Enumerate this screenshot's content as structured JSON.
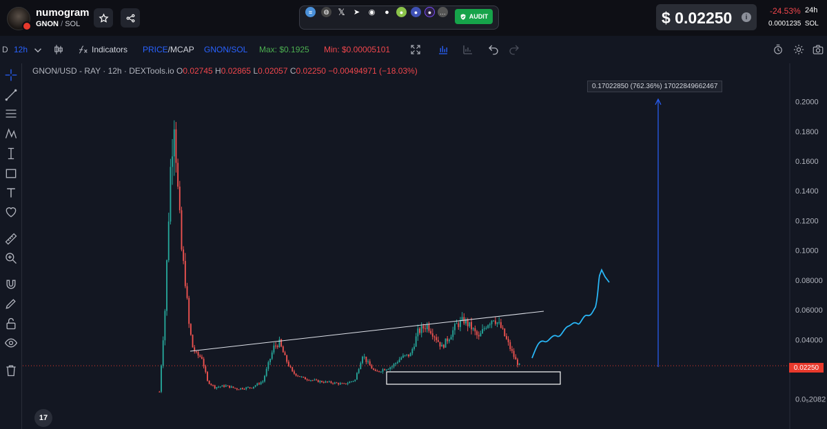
{
  "header": {
    "token_name": "numogram",
    "token_symbol": "GNON",
    "pair_sep": "/",
    "quote": "SOL",
    "audit_label": "AUDIT",
    "price": "$ 0.02250",
    "info_glyph": "i",
    "change": "-24.53%",
    "change_period": "24h",
    "sol_price": "0.0001235",
    "sol_label": "SOL",
    "socials": [
      "website-icon",
      "globe-icon",
      "x-icon",
      "telegram-icon",
      "reddit-icon",
      "github-icon",
      "coingecko-icon",
      "cmc-icon",
      "dextools-icon",
      "more-icon"
    ]
  },
  "toolbar": {
    "d_label": "D",
    "interval": "12h",
    "indicators": "Indicators",
    "price_mcap_a": "PRICE",
    "price_mcap_sep": "/",
    "price_mcap_b": "MCAP",
    "pair_toggle": "GNON/SOL",
    "max": "Max: $0.1925",
    "min": "Min: $0.00005101"
  },
  "legend": {
    "title": "GNON/USD - RAY · 12h · DEXTools.io",
    "o_label": "O",
    "o_val": "0.02745",
    "h_label": "H",
    "h_val": "0.02865",
    "l_label": "L",
    "l_val": "0.02057",
    "c_label": "C",
    "c_val": "0.02250",
    "change": "−0.00494971 (−18.03%)"
  },
  "measure_label": "0.17022850 (762.36%) 17022849662467",
  "current_price_tag": "0.02250",
  "tv_logo": "17",
  "colors": {
    "up": "#26a69a",
    "down": "#ef5350",
    "accent": "#2962ff",
    "drawing": "#29b6f6",
    "price_tag": "#e8392c"
  },
  "chart_data": {
    "type": "candlestick",
    "title": "GNON/USD - RAY · 12h · DEXTools.io",
    "y_ticks": [
      "0.2000",
      "0.1800",
      "0.1600",
      "0.1400",
      "0.1200",
      "0.1000",
      "0.08000",
      "0.06000",
      "0.04000",
      "0.02250",
      "0.0₅2082"
    ],
    "y_tick_values": [
      0.2,
      0.18,
      0.16,
      0.14,
      0.12,
      0.1,
      0.08,
      0.06,
      0.04,
      0.0225,
      0.0
    ],
    "ylim": [
      -0.002,
      0.21
    ],
    "approx_path": [
      [
        0,
        0.005
      ],
      [
        3,
        0.06
      ],
      [
        6,
        0.155
      ],
      [
        8,
        0.19
      ],
      [
        10,
        0.14
      ],
      [
        12,
        0.1
      ],
      [
        14,
        0.08
      ],
      [
        16,
        0.05
      ],
      [
        18,
        0.035
      ],
      [
        20,
        0.03
      ],
      [
        23,
        0.028
      ],
      [
        26,
        0.012
      ],
      [
        30,
        0.008
      ],
      [
        36,
        0.009
      ],
      [
        42,
        0.007
      ],
      [
        50,
        0.008
      ],
      [
        56,
        0.012
      ],
      [
        62,
        0.035
      ],
      [
        65,
        0.038
      ],
      [
        68,
        0.028
      ],
      [
        72,
        0.018
      ],
      [
        78,
        0.014
      ],
      [
        86,
        0.012
      ],
      [
        94,
        0.011
      ],
      [
        100,
        0.01
      ],
      [
        106,
        0.013
      ],
      [
        110,
        0.03
      ],
      [
        113,
        0.024
      ],
      [
        117,
        0.018
      ],
      [
        121,
        0.02
      ],
      [
        126,
        0.022
      ],
      [
        131,
        0.028
      ],
      [
        136,
        0.03
      ],
      [
        140,
        0.045
      ],
      [
        145,
        0.05
      ],
      [
        149,
        0.043
      ],
      [
        153,
        0.035
      ],
      [
        157,
        0.042
      ],
      [
        161,
        0.05
      ],
      [
        165,
        0.053
      ],
      [
        169,
        0.048
      ],
      [
        173,
        0.041
      ],
      [
        177,
        0.05
      ],
      [
        181,
        0.055
      ],
      [
        185,
        0.048
      ],
      [
        189,
        0.037
      ],
      [
        193,
        0.026
      ],
      [
        195,
        0.0225
      ]
    ],
    "trendline": [
      [
        0.033,
        "left"
      ],
      [
        0.057,
        "right"
      ]
    ],
    "measure_up": 0.1702285,
    "measure_pct": "762.36%"
  }
}
